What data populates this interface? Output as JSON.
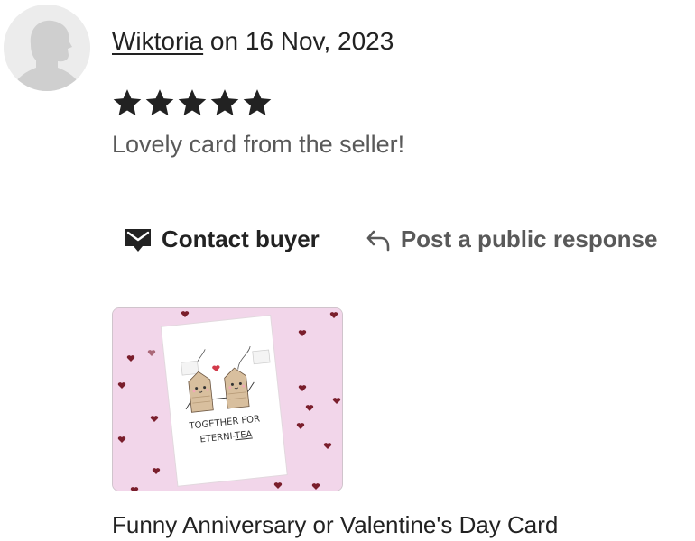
{
  "reviewer": {
    "name": "Wiktoria",
    "date_text": " on 16 Nov, 2023"
  },
  "rating": 5,
  "review_text": "Lovely card from the seller!",
  "actions": {
    "contact_label": "Contact buyer",
    "public_response_label": "Post a public response"
  },
  "product": {
    "card_line1": "TOGETHER FOR",
    "card_line2_part1": "ETERNI-",
    "card_line2_part2": "TEA",
    "title": "Funny Anniversary or Valentine's Day Card"
  },
  "colors": {
    "text": "#222222",
    "muted_text": "#595959",
    "thumb_background": "#f2d6ea",
    "heart": "#7a1e2c"
  },
  "icons": {
    "avatar": "default-user-silhouette",
    "star": "filled-star-icon",
    "contact": "envelope-chat-icon",
    "public_response": "reply-arrow-icon"
  }
}
